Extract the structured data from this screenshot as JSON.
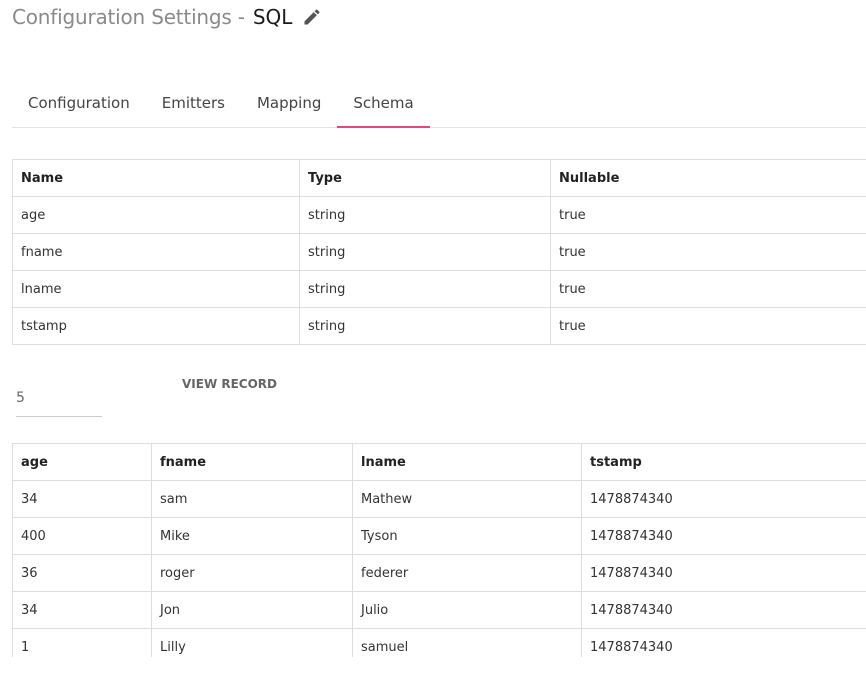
{
  "header": {
    "title_prefix": "Configuration Settings -",
    "title_name": "SQL",
    "edit_icon": "pencil-icon"
  },
  "tabs": [
    {
      "label": "Configuration",
      "active": false
    },
    {
      "label": "Emitters",
      "active": false
    },
    {
      "label": "Mapping",
      "active": false
    },
    {
      "label": "Schema",
      "active": true
    }
  ],
  "schema_table": {
    "columns": [
      "Name",
      "Type",
      "Nullable"
    ],
    "rows": [
      [
        "age",
        "string",
        "true"
      ],
      [
        "fname",
        "string",
        "true"
      ],
      [
        "lname",
        "string",
        "true"
      ],
      [
        "tstamp",
        "string",
        "true"
      ]
    ]
  },
  "record_controls": {
    "count_value": "5",
    "view_button_label": "VIEW RECORD"
  },
  "records_table": {
    "columns": [
      "age",
      "fname",
      "lname",
      "tstamp"
    ],
    "rows": [
      [
        "34",
        "sam",
        "Mathew",
        "1478874340"
      ],
      [
        "400",
        "Mike",
        "Tyson",
        "1478874340"
      ],
      [
        "36",
        "roger",
        "federer",
        "1478874340"
      ],
      [
        "34",
        "Jon",
        "Julio",
        "1478874340"
      ],
      [
        "1",
        "Lilly",
        "samuel",
        "1478874340"
      ]
    ]
  },
  "colors": {
    "active_tab_underline": "#e2487a",
    "title_prefix": "#8a8a8a"
  }
}
